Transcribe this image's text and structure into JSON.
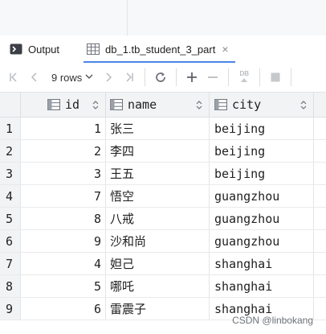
{
  "tabs": [
    {
      "label": "Output",
      "icon": "console-icon",
      "closable": false,
      "active": false
    },
    {
      "label": "db_1.tb_student_3_part",
      "icon": "table-icon",
      "closable": true,
      "active": true,
      "close_glyph": "×"
    }
  ],
  "toolbar": {
    "first_glyph": "|<",
    "prev_glyph": "<",
    "rows_label": "9 rows",
    "next_glyph": ">",
    "last_glyph": ">|",
    "refresh_icon": "refresh-icon",
    "add_glyph": "+",
    "remove_glyph": "−",
    "db_label": "DB",
    "stop_icon": "stop-icon"
  },
  "table": {
    "columns": [
      {
        "name": "id"
      },
      {
        "name": "name"
      },
      {
        "name": "city"
      }
    ],
    "rows": [
      {
        "n": "1",
        "id": "1",
        "name": "张三",
        "city": "beijing"
      },
      {
        "n": "2",
        "id": "2",
        "name": "李四",
        "city": "beijing"
      },
      {
        "n": "3",
        "id": "3",
        "name": "王五",
        "city": "beijing"
      },
      {
        "n": "4",
        "id": "7",
        "name": "悟空",
        "city": "guangzhou"
      },
      {
        "n": "5",
        "id": "8",
        "name": "八戒",
        "city": "guangzhou"
      },
      {
        "n": "6",
        "id": "9",
        "name": "沙和尚",
        "city": "guangzhou"
      },
      {
        "n": "7",
        "id": "4",
        "name": "妲己",
        "city": "shanghai"
      },
      {
        "n": "8",
        "id": "5",
        "name": "哪吒",
        "city": "shanghai"
      },
      {
        "n": "9",
        "id": "6",
        "name": "雷震子",
        "city": "shanghai"
      }
    ]
  },
  "watermark": "CSDN @linbokang",
  "colors": {
    "accent": "#4a86e8",
    "header_bg": "#f2f3f5"
  }
}
